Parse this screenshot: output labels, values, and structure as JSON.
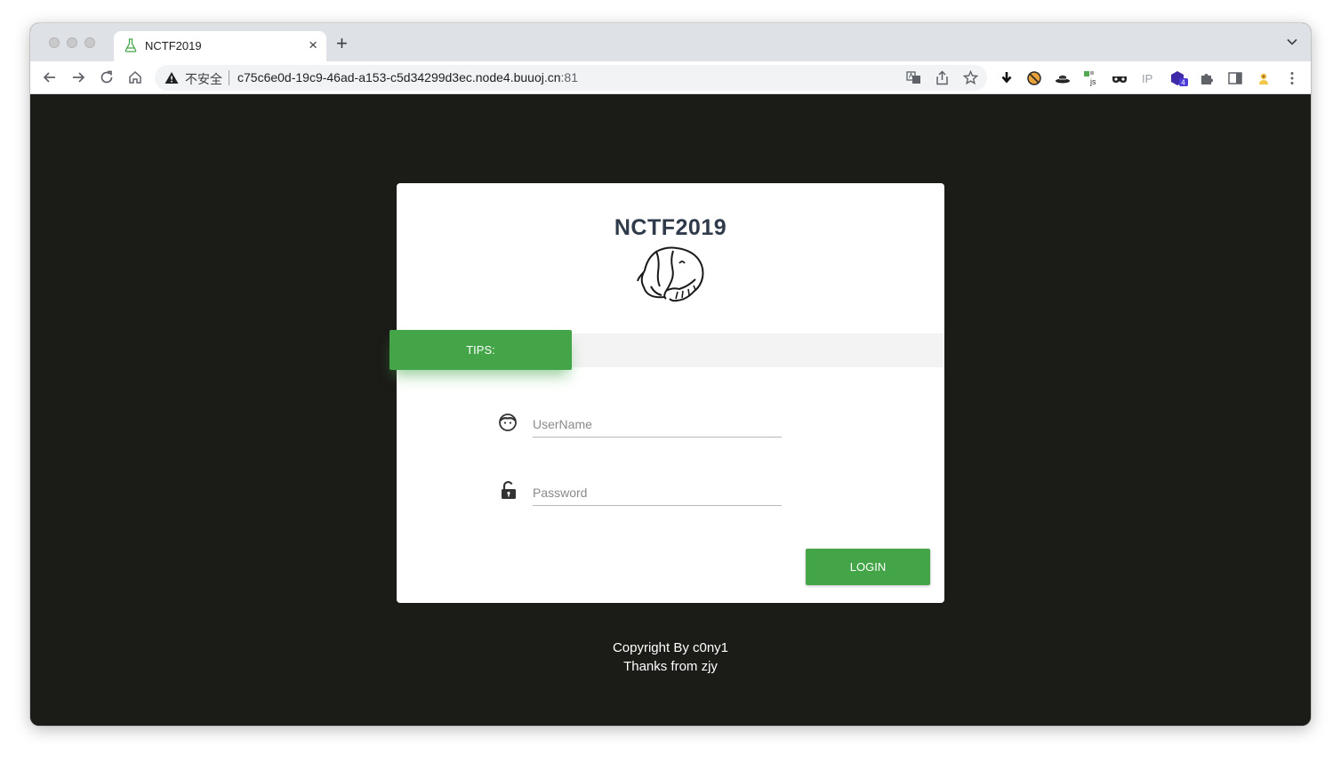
{
  "browser": {
    "tab": {
      "title": "NCTF2019",
      "close": "×"
    },
    "new_tab": "+",
    "address": {
      "security_label": "不安全",
      "url_host": "c75c6e0d-19c9-46ad-a153-c5d34299d3ec.node4.buuoj.cn",
      "url_port": ":81"
    },
    "extension_badge": "4",
    "extension_ip": "IP"
  },
  "page": {
    "brand": "NCTF2019",
    "tips_label": "TIPS:",
    "username_placeholder": "UserName",
    "password_placeholder": "Password",
    "login_label": "LOGIN",
    "footer": {
      "line1": "Copyright By c0ny1",
      "line2": "Thanks from zjy"
    }
  },
  "colors": {
    "accent_green": "#43a548",
    "page_background": "#1b1b18",
    "title_text": "#2f3a4a"
  }
}
